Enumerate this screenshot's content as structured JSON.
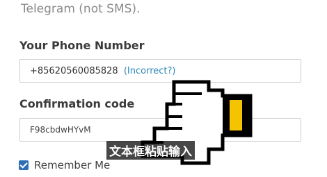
{
  "intro": {
    "text": "Telegram (not SMS)."
  },
  "phone": {
    "label": "Your Phone Number",
    "value": "+85620560085828",
    "incorrect_link": "(Incorrect?)"
  },
  "code": {
    "label": "Confirmation code",
    "value": "F98cbdwHYvM"
  },
  "remember": {
    "label": "Remember Me",
    "checked": true
  },
  "overlay": {
    "caption": "文本框粘贴输入",
    "hand_icon": "pointing-hand-icon",
    "colors": {
      "accent": "#f5c400",
      "checkbox": "#2c6fb7",
      "link": "#2d86b9"
    }
  }
}
